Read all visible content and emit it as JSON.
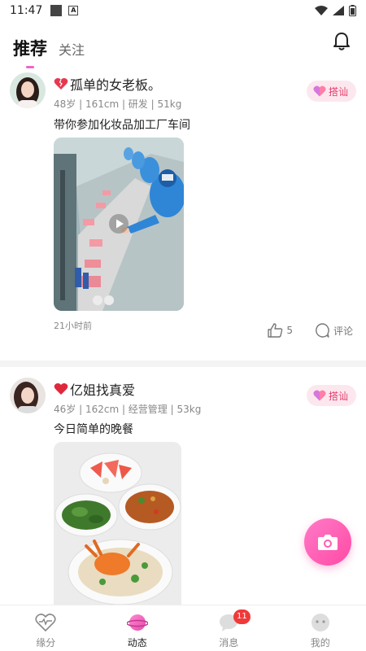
{
  "status_bar": {
    "time": "11:47",
    "icons": [
      "square-icon",
      "a-icon",
      "wifi-icon",
      "signal-icon",
      "battery-icon"
    ]
  },
  "top_nav": {
    "tabs": [
      {
        "label": "推荐",
        "active": true
      },
      {
        "label": "关注",
        "active": false
      }
    ],
    "right_icon": "bell-icon"
  },
  "posts": [
    {
      "name": "孤单的女老板。",
      "heart_icon": "broken-heart-icon",
      "meta": "48岁 | 161cm | 研发 | 51kg",
      "content": "带你参加化妆品加工厂车间",
      "media": "video-thumbnail",
      "say_hi": "搭讪",
      "time_ago": "21小时前",
      "likes": "5",
      "comment_label": "评论"
    },
    {
      "name": "亿姐找真爱",
      "heart_icon": "heart-icon",
      "meta": "46岁 | 162cm | 经营管理 | 53kg",
      "content": "今日简单的晚餐",
      "media": "photo",
      "say_hi": "搭讪"
    }
  ],
  "fab": {
    "icon": "camera-icon"
  },
  "bottom_nav": {
    "items": [
      {
        "label": "缘分",
        "icon": "heartbeat-icon",
        "active": false
      },
      {
        "label": "动态",
        "icon": "planet-icon",
        "active": true
      },
      {
        "label": "消息",
        "icon": "chat-icon",
        "active": false,
        "badge": "11"
      },
      {
        "label": "我的",
        "icon": "profile-icon",
        "active": false
      }
    ]
  },
  "colors": {
    "accent": "#f064c8",
    "say_hi_bg": "#fde7ef",
    "say_hi_text": "#e23c6a",
    "badge": "#f03a3a"
  }
}
